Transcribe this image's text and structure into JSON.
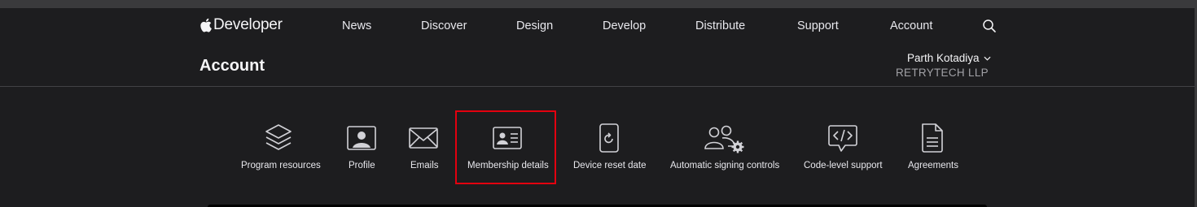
{
  "brand": {
    "name": "Developer",
    "logo_icon": "apple-logo-icon"
  },
  "nav": {
    "items": [
      {
        "label": "News"
      },
      {
        "label": "Discover"
      },
      {
        "label": "Design"
      },
      {
        "label": "Develop"
      },
      {
        "label": "Distribute"
      },
      {
        "label": "Support"
      },
      {
        "label": "Account"
      }
    ],
    "search_icon": "search-icon"
  },
  "account": {
    "title": "Account",
    "user_name": "Parth Kotadiya",
    "organization": "RETRYTECH LLP"
  },
  "tabs": [
    {
      "label": "Program resources",
      "icon": "stack-icon"
    },
    {
      "label": "Profile",
      "icon": "profile-photo-icon"
    },
    {
      "label": "Emails",
      "icon": "envelope-icon"
    },
    {
      "label": "Membership details",
      "icon": "id-card-icon",
      "highlighted": true
    },
    {
      "label": "Device reset date",
      "icon": "device-reset-icon"
    },
    {
      "label": "Automatic signing controls",
      "icon": "people-gear-icon"
    },
    {
      "label": "Code-level support",
      "icon": "code-bubble-icon"
    },
    {
      "label": "Agreements",
      "icon": "document-icon"
    }
  ],
  "colors": {
    "background": "#1d1d1f",
    "text": "#f5f5f7",
    "secondary_text": "#a1a1a6",
    "highlight_border": "#e3000f"
  }
}
